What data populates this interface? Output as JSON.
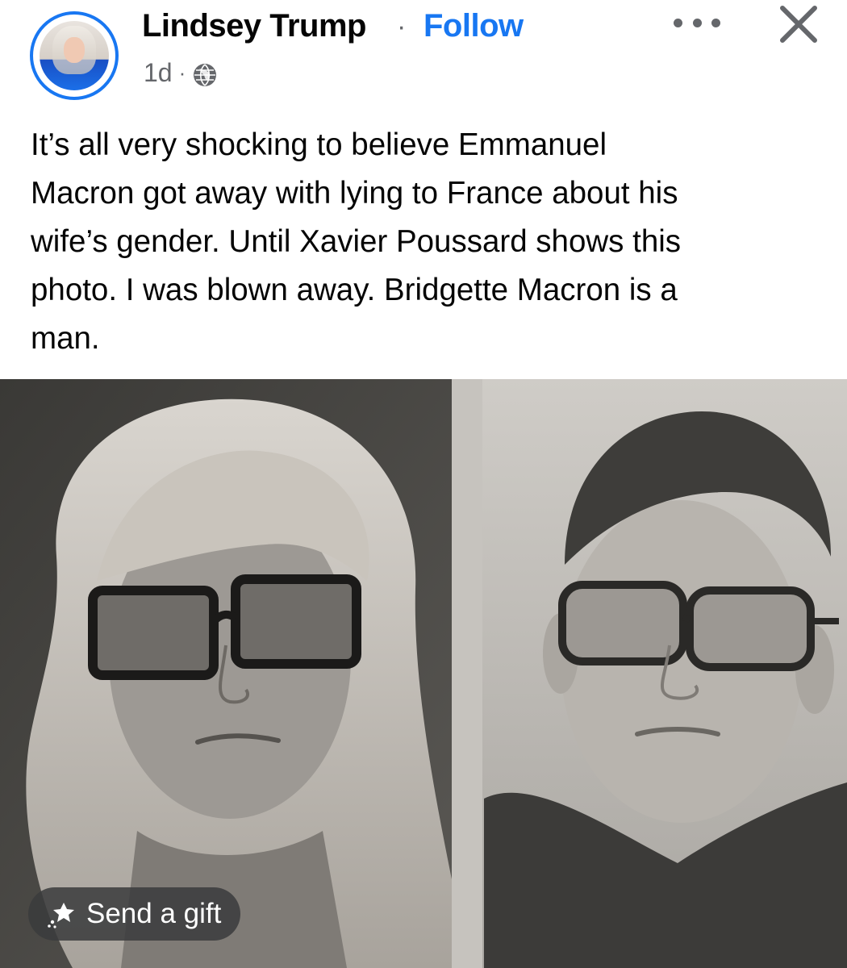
{
  "post": {
    "author": {
      "name": "Lindsey Trump",
      "avatar_icon": "profile-photo-avatar"
    },
    "separator": "·",
    "follow_label": "Follow",
    "timestamp": "1d",
    "meta_separator": "·",
    "privacy_icon": "globe-icon",
    "more_icon": "more-options-icon",
    "close_icon": "close-icon",
    "text": "It’s all very shocking to believe Emmanuel\nMacron got away with lying to France about his\nwife’s gender. Until Xavier Poussard shows this\nphoto. I was blown away. Bridgette Macron is a\nman.",
    "photo": {
      "description_icon": "side-by-side-newspaper-portraits"
    },
    "gift_button": {
      "label": "Send a gift",
      "icon": "gift-icon"
    }
  },
  "colors": {
    "accent": "#1877f2",
    "text": "#050505",
    "secondary_text": "#65676b",
    "gift_button_bg": "#3a3b3c"
  }
}
